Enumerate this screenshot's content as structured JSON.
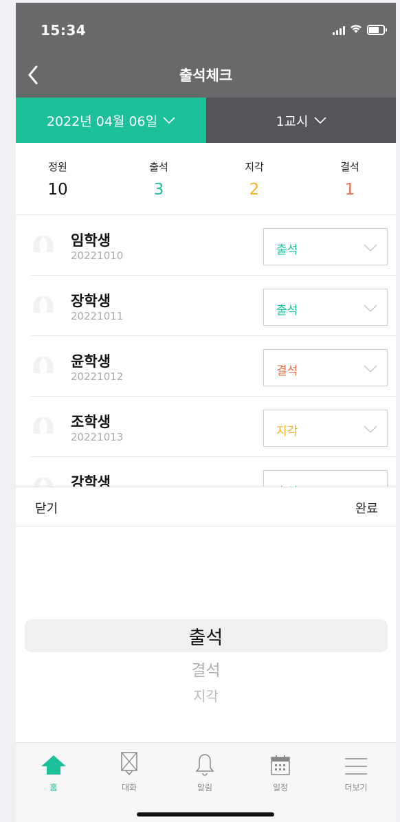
{
  "status_bar": {
    "time": "15:34"
  },
  "header": {
    "title": "출석체크"
  },
  "selector": {
    "date": "2022년 04월 06일",
    "period": "1교시"
  },
  "summary": {
    "capacity_label": "정원",
    "capacity_value": "10",
    "present_label": "출석",
    "present_value": "3",
    "late_label": "지각",
    "late_value": "2",
    "absent_label": "결석",
    "absent_value": "1"
  },
  "students": [
    {
      "name": "임학생",
      "id": "20221010",
      "status": "출석"
    },
    {
      "name": "장학생",
      "id": "20221011",
      "status": "출석"
    },
    {
      "name": "윤학생",
      "id": "20221012",
      "status": "결석"
    },
    {
      "name": "조학생",
      "id": "20221013",
      "status": "지각"
    },
    {
      "name": "강학생",
      "id": "",
      "status": "출석"
    }
  ],
  "picker": {
    "close_label": "닫기",
    "done_label": "완료",
    "options": [
      "출석",
      "결석",
      "지각"
    ]
  },
  "tabbar": {
    "items": [
      {
        "label": "홈",
        "icon": "home-icon"
      },
      {
        "label": "대화",
        "icon": "chat-icon"
      },
      {
        "label": "알림",
        "icon": "bell-icon"
      },
      {
        "label": "일정",
        "icon": "calendar-icon"
      },
      {
        "label": "더보기",
        "icon": "menu-icon"
      }
    ]
  },
  "colors": {
    "accent": "#1cc19a",
    "present": "#1cc19a",
    "late": "#f5b324",
    "absent": "#ef6f4a",
    "header": "#69696c"
  }
}
